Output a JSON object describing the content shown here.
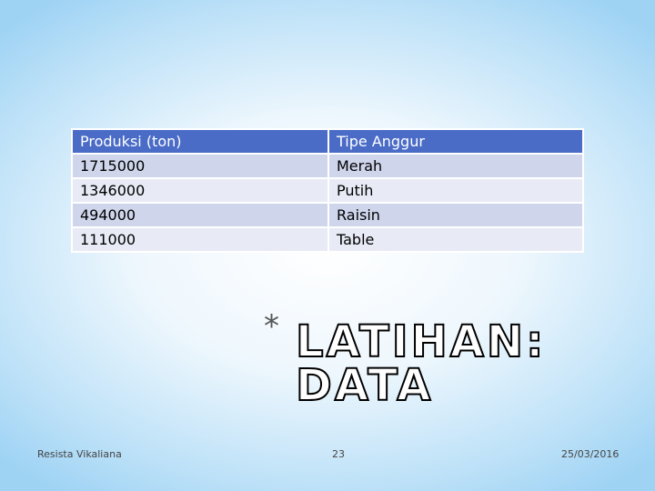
{
  "table": {
    "headers": [
      "Produksi (ton)",
      "Tipe Anggur"
    ],
    "rows": [
      [
        "1715000",
        "Merah"
      ],
      [
        "1346000",
        "Putih"
      ],
      [
        "494000",
        "Raisin"
      ],
      [
        "111000",
        "Table"
      ]
    ]
  },
  "title": {
    "bullet": "*",
    "text": "LATIHAN: DATA"
  },
  "footer": {
    "author": "Resista Vikaliana",
    "page_number": "23",
    "date": "25/03/2016"
  },
  "colors": {
    "header_bg": "#4a6cc7",
    "row_odd_bg": "#cfd6ec",
    "row_even_bg": "#e8ebf6"
  }
}
